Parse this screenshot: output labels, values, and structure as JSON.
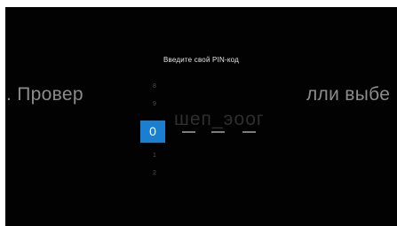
{
  "background": {
    "left_text": ". Провер",
    "right_text": "лли выбе",
    "faded_text": "шеп_эоог"
  },
  "pin_dialog": {
    "title": "Введите свой PIN-код",
    "digit_above_2": "8",
    "digit_above_1": "9",
    "selected_digit": "0",
    "digit_below_1": "1",
    "digit_below_2": "2",
    "slots_total": 4,
    "slots_filled": 1
  },
  "colors": {
    "accent": "#1a7fd1",
    "background": "#020202"
  }
}
